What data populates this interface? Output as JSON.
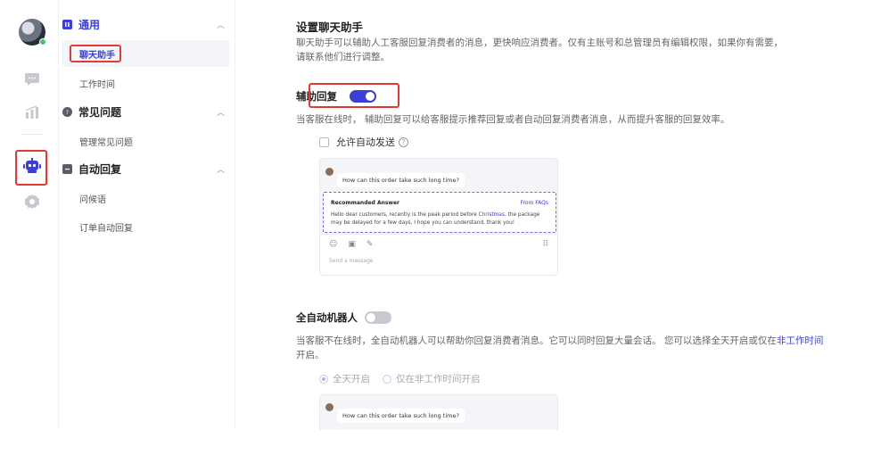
{
  "rail": {
    "icons": [
      "avatar",
      "chat-bubble-icon",
      "bar-chart-icon",
      "robot-icon",
      "gear-icon"
    ],
    "active": "robot-icon",
    "active_color": "#3b3fd8"
  },
  "menu": {
    "groups": [
      {
        "label": "通用",
        "icon": "info-square-icon",
        "items": [
          "聊天助手",
          "工作时间"
        ]
      },
      {
        "label": "常见问题",
        "icon": "question-circle-icon",
        "items": [
          "管理常见问题"
        ]
      },
      {
        "label": "自动回复",
        "icon": "message-square-icon",
        "items": [
          "问候语",
          "订单自动回复"
        ]
      }
    ],
    "active_item": "聊天助手"
  },
  "main": {
    "title": "设置聊天助手",
    "intro_line1": "聊天助手可以辅助人工客服回复消费者的消息，更快响应消费者。仅有主账号和总管理员有编辑权限，如果你有需要，",
    "intro_line2": "请联系他们进行调整。",
    "assist": {
      "label": "辅助回复",
      "enabled": true,
      "desc": "当客服在线时， 辅助回复可以给客服提示推荐回复或者自动回复消费者消息，从而提升客服的回复效率。",
      "auto_send_label": "允许自动发送",
      "auto_send_checked": false
    },
    "preview": {
      "question": "How can this order take such long time?",
      "rec_title": "Recommanded Answer",
      "rec_source": "From FAQs",
      "rec_body_1": "Hello dear customers, recently is the peak period before ",
      "rec_body_kw": "Christmas",
      "rec_body_2": ", the package may be delayed for a few days, I hope you can understand, thank you!",
      "placeholder": "Send a message"
    },
    "robot": {
      "label": "全自动机器人",
      "enabled": false,
      "desc_1": "当客服不在线时，全自动机器人可以帮助你回复消费者消息。它可以同时回复大量会话。 您可以选择全天开启或仅在",
      "desc_link": "非工作时间",
      "desc_2": "开启。",
      "options": [
        "全天开启",
        "仅在非工作时间开启"
      ],
      "selected": "全天开启"
    },
    "preview2": {
      "question": "How can this order take such long time?"
    }
  },
  "colors": {
    "accent": "#3b3fd8",
    "highlight": "#e53935",
    "toggle_off": "#c8cad2"
  }
}
